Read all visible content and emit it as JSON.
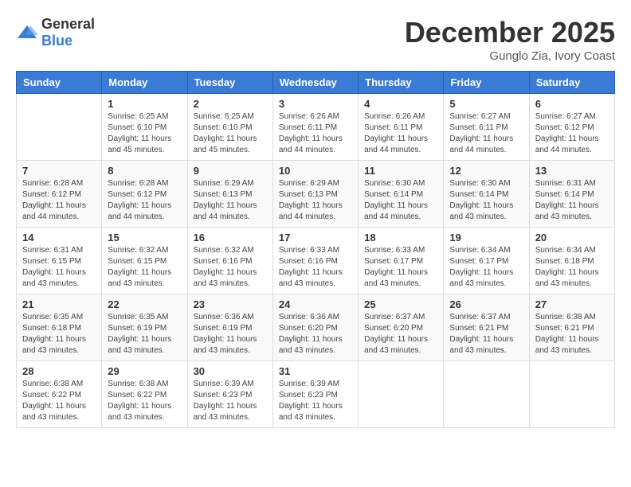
{
  "header": {
    "logo_general": "General",
    "logo_blue": "Blue",
    "month": "December 2025",
    "location": "Gunglo Zia, Ivory Coast"
  },
  "weekdays": [
    "Sunday",
    "Monday",
    "Tuesday",
    "Wednesday",
    "Thursday",
    "Friday",
    "Saturday"
  ],
  "weeks": [
    [
      {
        "day": "",
        "info": ""
      },
      {
        "day": "1",
        "info": "Sunrise: 6:25 AM\nSunset: 6:10 PM\nDaylight: 11 hours\nand 45 minutes."
      },
      {
        "day": "2",
        "info": "Sunrise: 6:25 AM\nSunset: 6:10 PM\nDaylight: 11 hours\nand 45 minutes."
      },
      {
        "day": "3",
        "info": "Sunrise: 6:26 AM\nSunset: 6:11 PM\nDaylight: 11 hours\nand 44 minutes."
      },
      {
        "day": "4",
        "info": "Sunrise: 6:26 AM\nSunset: 6:11 PM\nDaylight: 11 hours\nand 44 minutes."
      },
      {
        "day": "5",
        "info": "Sunrise: 6:27 AM\nSunset: 6:11 PM\nDaylight: 11 hours\nand 44 minutes."
      },
      {
        "day": "6",
        "info": "Sunrise: 6:27 AM\nSunset: 6:12 PM\nDaylight: 11 hours\nand 44 minutes."
      }
    ],
    [
      {
        "day": "7",
        "info": "Sunrise: 6:28 AM\nSunset: 6:12 PM\nDaylight: 11 hours\nand 44 minutes."
      },
      {
        "day": "8",
        "info": "Sunrise: 6:28 AM\nSunset: 6:12 PM\nDaylight: 11 hours\nand 44 minutes."
      },
      {
        "day": "9",
        "info": "Sunrise: 6:29 AM\nSunset: 6:13 PM\nDaylight: 11 hours\nand 44 minutes."
      },
      {
        "day": "10",
        "info": "Sunrise: 6:29 AM\nSunset: 6:13 PM\nDaylight: 11 hours\nand 44 minutes."
      },
      {
        "day": "11",
        "info": "Sunrise: 6:30 AM\nSunset: 6:14 PM\nDaylight: 11 hours\nand 44 minutes."
      },
      {
        "day": "12",
        "info": "Sunrise: 6:30 AM\nSunset: 6:14 PM\nDaylight: 11 hours\nand 43 minutes."
      },
      {
        "day": "13",
        "info": "Sunrise: 6:31 AM\nSunset: 6:14 PM\nDaylight: 11 hours\nand 43 minutes."
      }
    ],
    [
      {
        "day": "14",
        "info": "Sunrise: 6:31 AM\nSunset: 6:15 PM\nDaylight: 11 hours\nand 43 minutes."
      },
      {
        "day": "15",
        "info": "Sunrise: 6:32 AM\nSunset: 6:15 PM\nDaylight: 11 hours\nand 43 minutes."
      },
      {
        "day": "16",
        "info": "Sunrise: 6:32 AM\nSunset: 6:16 PM\nDaylight: 11 hours\nand 43 minutes."
      },
      {
        "day": "17",
        "info": "Sunrise: 6:33 AM\nSunset: 6:16 PM\nDaylight: 11 hours\nand 43 minutes."
      },
      {
        "day": "18",
        "info": "Sunrise: 6:33 AM\nSunset: 6:17 PM\nDaylight: 11 hours\nand 43 minutes."
      },
      {
        "day": "19",
        "info": "Sunrise: 6:34 AM\nSunset: 6:17 PM\nDaylight: 11 hours\nand 43 minutes."
      },
      {
        "day": "20",
        "info": "Sunrise: 6:34 AM\nSunset: 6:18 PM\nDaylight: 11 hours\nand 43 minutes."
      }
    ],
    [
      {
        "day": "21",
        "info": "Sunrise: 6:35 AM\nSunset: 6:18 PM\nDaylight: 11 hours\nand 43 minutes."
      },
      {
        "day": "22",
        "info": "Sunrise: 6:35 AM\nSunset: 6:19 PM\nDaylight: 11 hours\nand 43 minutes."
      },
      {
        "day": "23",
        "info": "Sunrise: 6:36 AM\nSunset: 6:19 PM\nDaylight: 11 hours\nand 43 minutes."
      },
      {
        "day": "24",
        "info": "Sunrise: 6:36 AM\nSunset: 6:20 PM\nDaylight: 11 hours\nand 43 minutes."
      },
      {
        "day": "25",
        "info": "Sunrise: 6:37 AM\nSunset: 6:20 PM\nDaylight: 11 hours\nand 43 minutes."
      },
      {
        "day": "26",
        "info": "Sunrise: 6:37 AM\nSunset: 6:21 PM\nDaylight: 11 hours\nand 43 minutes."
      },
      {
        "day": "27",
        "info": "Sunrise: 6:38 AM\nSunset: 6:21 PM\nDaylight: 11 hours\nand 43 minutes."
      }
    ],
    [
      {
        "day": "28",
        "info": "Sunrise: 6:38 AM\nSunset: 6:22 PM\nDaylight: 11 hours\nand 43 minutes."
      },
      {
        "day": "29",
        "info": "Sunrise: 6:38 AM\nSunset: 6:22 PM\nDaylight: 11 hours\nand 43 minutes."
      },
      {
        "day": "30",
        "info": "Sunrise: 6:39 AM\nSunset: 6:23 PM\nDaylight: 11 hours\nand 43 minutes."
      },
      {
        "day": "31",
        "info": "Sunrise: 6:39 AM\nSunset: 6:23 PM\nDaylight: 11 hours\nand 43 minutes."
      },
      {
        "day": "",
        "info": ""
      },
      {
        "day": "",
        "info": ""
      },
      {
        "day": "",
        "info": ""
      }
    ]
  ]
}
